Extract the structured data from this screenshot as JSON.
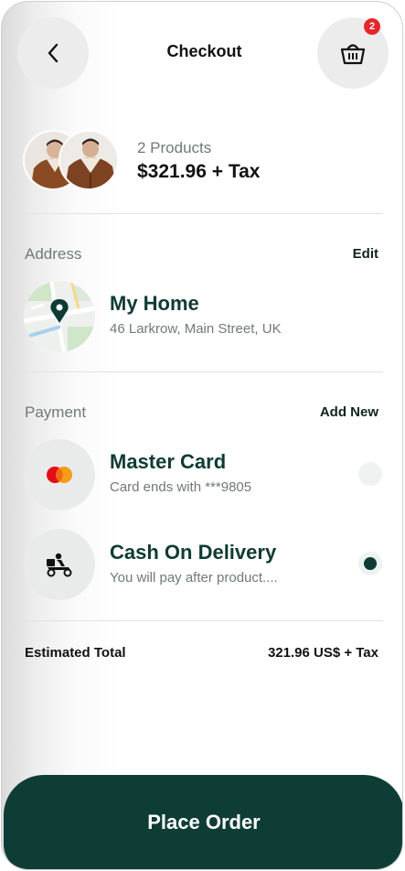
{
  "header": {
    "title": "Checkout",
    "cart_count": "2"
  },
  "products": {
    "count_label": "2 Products",
    "price_label": "$321.96 + Tax"
  },
  "address": {
    "section_label": "Address",
    "action_label": "Edit",
    "name": "My Home",
    "detail": "46 Larkrow, Main Street, UK"
  },
  "payment": {
    "section_label": "Payment",
    "action_label": "Add New",
    "methods": [
      {
        "title": "Master Card",
        "subtitle": "Card ends with ***9805",
        "icon": "mastercard-icon",
        "selected": false
      },
      {
        "title": "Cash On Delivery",
        "subtitle": "You will pay after product....",
        "icon": "delivery-scooter-icon",
        "selected": true
      }
    ]
  },
  "summary": {
    "total_label": "Estimated Total",
    "total_value": "321.96 US$ + Tax"
  },
  "cta": {
    "place_order_label": "Place Order"
  },
  "colors": {
    "brand_dark": "#0e3d36",
    "badge_red": "#e5262b",
    "mastercard_red": "#e30d17",
    "mastercard_orange": "#f59c1a"
  }
}
